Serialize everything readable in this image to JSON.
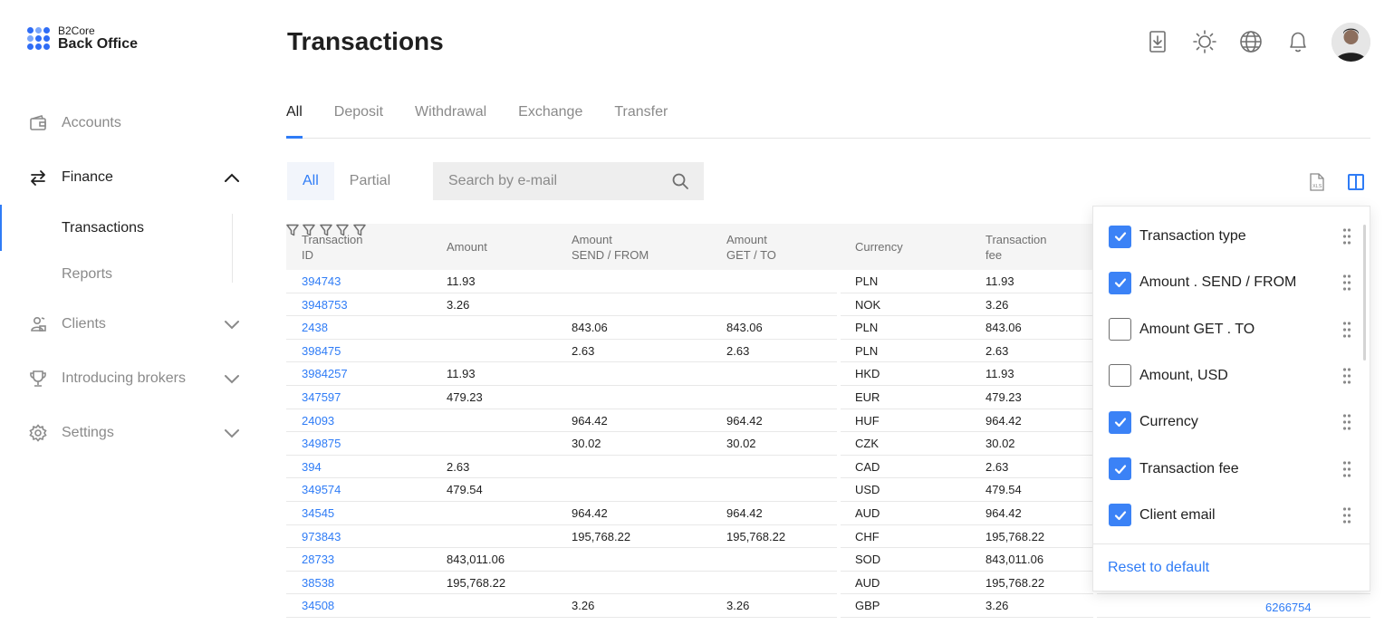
{
  "brand": {
    "sub": "B2Core",
    "main": "Back Office",
    "accent": "#2f7cf6"
  },
  "sidebar": {
    "items": [
      {
        "label": "Accounts",
        "icon": "wallet-icon"
      },
      {
        "label": "Finance",
        "icon": "arrows-swap-icon",
        "expanded": true,
        "children": [
          {
            "label": "Transactions",
            "active": true
          },
          {
            "label": "Reports"
          }
        ]
      },
      {
        "label": "Clients",
        "icon": "clients-icon"
      },
      {
        "label": "Introducing brokers",
        "icon": "trophy-icon"
      },
      {
        "label": "Settings",
        "icon": "gear-icon"
      }
    ]
  },
  "header": {
    "title": "Transactions"
  },
  "tabs": [
    {
      "label": "All",
      "active": true
    },
    {
      "label": "Deposit"
    },
    {
      "label": "Withdrawal"
    },
    {
      "label": "Exchange"
    },
    {
      "label": "Transfer"
    }
  ],
  "filter": {
    "segments": [
      {
        "label": "All",
        "active": true
      },
      {
        "label": "Partial"
      }
    ],
    "search_placeholder": "Search by e-mail"
  },
  "table": {
    "headers": [
      {
        "line1": "Transaction",
        "line2": "ID"
      },
      {
        "line1": "Amount",
        "line2": ""
      },
      {
        "line1": "Amount",
        "line2": "SEND / FROM"
      },
      {
        "line1": "Amount",
        "line2": "GET / TO"
      },
      {
        "line1": "Currency",
        "line2": ""
      },
      {
        "line1": "Transaction",
        "line2": "fee"
      }
    ],
    "rows": [
      [
        "394743",
        "11.93",
        "",
        "",
        "PLN",
        "11.93"
      ],
      [
        "3948753",
        "3.26",
        "",
        "",
        "NOK",
        "3.26"
      ],
      [
        "2438",
        "",
        "843.06",
        "843.06",
        "PLN",
        "843.06"
      ],
      [
        "398475",
        "",
        "2.63",
        "2.63",
        "PLN",
        "2.63"
      ],
      [
        "3984257",
        "11.93",
        "",
        "",
        "HKD",
        "11.93"
      ],
      [
        "347597",
        "479.23",
        "",
        "",
        "EUR",
        "479.23"
      ],
      [
        "24093",
        "",
        "964.42",
        "964.42",
        "HUF",
        "964.42"
      ],
      [
        "349875",
        "",
        "30.02",
        "30.02",
        "CZK",
        "30.02"
      ],
      [
        "394",
        "2.63",
        "",
        "",
        "CAD",
        "2.63"
      ],
      [
        "349574",
        "479.54",
        "",
        "",
        "USD",
        "479.54"
      ],
      [
        "34545",
        "",
        "964.42",
        "964.42",
        "AUD",
        "964.42"
      ],
      [
        "973843",
        "",
        "195,768.22",
        "195,768.22",
        "CHF",
        "195,768.22"
      ],
      [
        "28733",
        "843,011.06",
        "",
        "",
        "SOD",
        "843,011.06"
      ],
      [
        "38538",
        "195,768.22",
        "",
        "",
        "AUD",
        "195,768.22"
      ],
      [
        "34508",
        "",
        "3.26",
        "3.26",
        "GBP",
        "3.26"
      ]
    ],
    "last_row_extra": "6266754"
  },
  "column_panel": {
    "options": [
      {
        "label": "Transaction type",
        "checked": true
      },
      {
        "label": "Amount . SEND / FROM",
        "checked": true
      },
      {
        "label": "Amount GET . TO",
        "checked": false
      },
      {
        "label": "Amount, USD",
        "checked": false
      },
      {
        "label": "Currency",
        "checked": true
      },
      {
        "label": "Transaction fee",
        "checked": true
      },
      {
        "label": "Client email",
        "checked": true
      }
    ],
    "reset_label": "Reset to default"
  }
}
